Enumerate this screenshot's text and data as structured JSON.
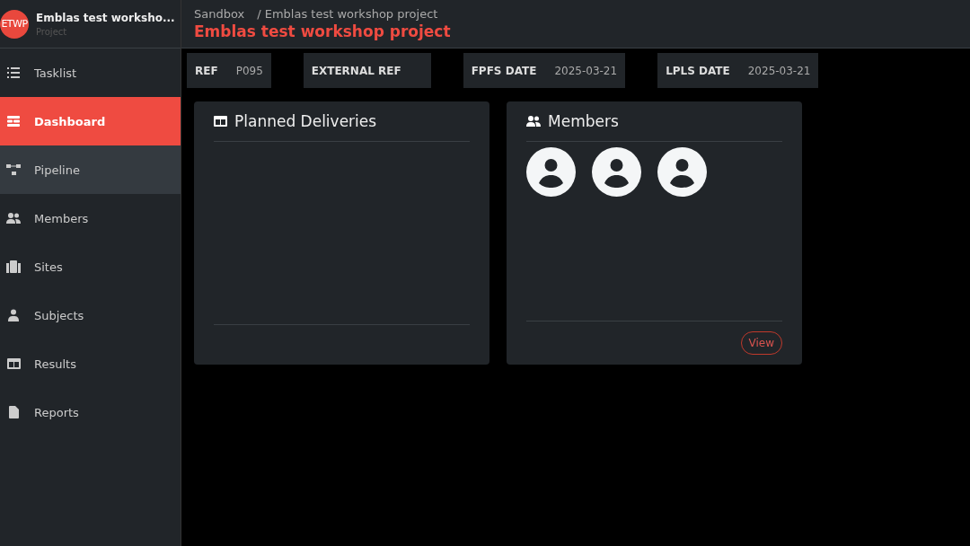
{
  "project": {
    "initials": "ETWP",
    "name": "Emblas test worksho...",
    "subtitle": "Project"
  },
  "nav": [
    {
      "kind": "list",
      "label": "Tasklist",
      "selected": false,
      "hovered": false
    },
    {
      "kind": "dashboard",
      "label": "Dashboard",
      "selected": true,
      "hovered": false
    },
    {
      "kind": "pipeline",
      "label": "Pipeline",
      "selected": false,
      "hovered": true
    },
    {
      "kind": "members",
      "label": "Members",
      "selected": false,
      "hovered": false
    },
    {
      "kind": "sites",
      "label": "Sites",
      "selected": false,
      "hovered": false
    },
    {
      "kind": "subjects",
      "label": "Subjects",
      "selected": false,
      "hovered": false
    },
    {
      "kind": "table",
      "label": "Results",
      "selected": false,
      "hovered": false
    },
    {
      "kind": "report",
      "label": "Reports",
      "selected": false,
      "hovered": false
    }
  ],
  "breadcrumb": [
    "Sandbox",
    "/ Emblas test workshop project"
  ],
  "title": "Emblas test workshop project",
  "info": [
    {
      "label": "REF",
      "value": "P095"
    },
    {
      "label": "EXTERNAL REF"
    },
    {
      "label": "FPFS DATE",
      "value": "2025-03-21"
    },
    {
      "label": "LPLS DATE",
      "value": "2025-03-21"
    }
  ],
  "cards": [
    {
      "kind": "table",
      "title": "Planned Deliveries"
    },
    {
      "kind": "members",
      "title": "Members",
      "avatars": [
        {
          "kind": "person"
        },
        {
          "kind": "person"
        },
        {
          "kind": "person"
        }
      ],
      "button": "View"
    }
  ]
}
